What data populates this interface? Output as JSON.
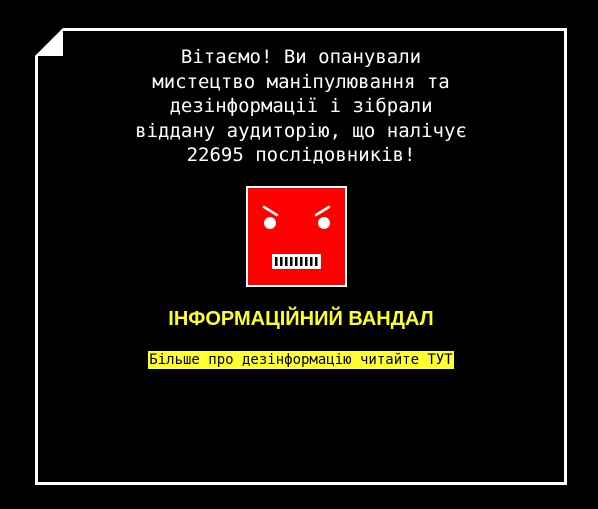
{
  "screen": {
    "message_lines": [
      "Вітаємо! Ви опанували",
      "мистецтво маніпулювання та",
      "дезінформації і зібрали",
      "віддану аудиторію, що налічує",
      "22695 послідовників!"
    ],
    "character_icon": "angry-red-square-face-icon",
    "title": "ІНФОРМАЦІЙНИЙ ВАНДАЛ",
    "link_text": "Більше про дезінформацію читайте ТУТ"
  },
  "colors": {
    "background": "#000000",
    "border": "#ffffff",
    "text": "#ffffff",
    "title": "#ffff22",
    "link_bg": "#ffff33",
    "face": "#ff0000"
  }
}
